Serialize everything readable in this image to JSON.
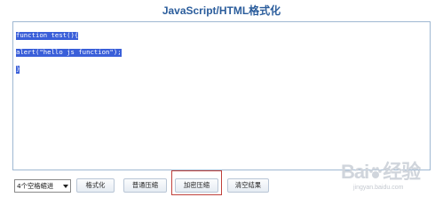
{
  "title": "JavaScript/HTML格式化",
  "editor": {
    "lines": [
      "function test(){",
      "alert(\"hello js function\");",
      "}"
    ]
  },
  "toolbar": {
    "indent_select_value": "4个空格缩进",
    "format_label": "格式化",
    "normal_compress_label": "普通压缩",
    "encrypt_compress_label": "加密压缩",
    "clear_label": "清空结果"
  },
  "watermark": {
    "brand": "Bai",
    "brand_suffix": "经验",
    "site": "jingyan.baidu.com"
  },
  "colors": {
    "title": "#2b5d9c",
    "selection": "#3a5fd9",
    "highlight": "#c0413b"
  }
}
